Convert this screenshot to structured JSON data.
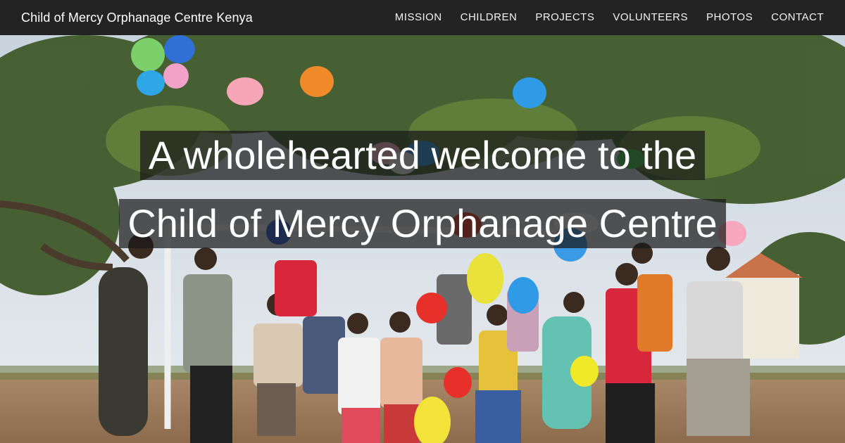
{
  "navbar": {
    "brand": "Child of Mercy Orphanage Centre Kenya",
    "links": [
      "MISSION",
      "CHILDREN",
      "PROJECTS",
      "VOLUNTEERS",
      "PHOTOS",
      "CONTACT"
    ]
  },
  "hero": {
    "headline_line1": "A wholehearted welcome to the",
    "headline_line2": "Child of Mercy Orphanage Centre",
    "photo": "children-celebrating-with-balloons"
  },
  "colors": {
    "navbar_bg": "#232323",
    "headline_bg": "rgba(25,25,25,0.72)",
    "text": "#ffffff"
  }
}
